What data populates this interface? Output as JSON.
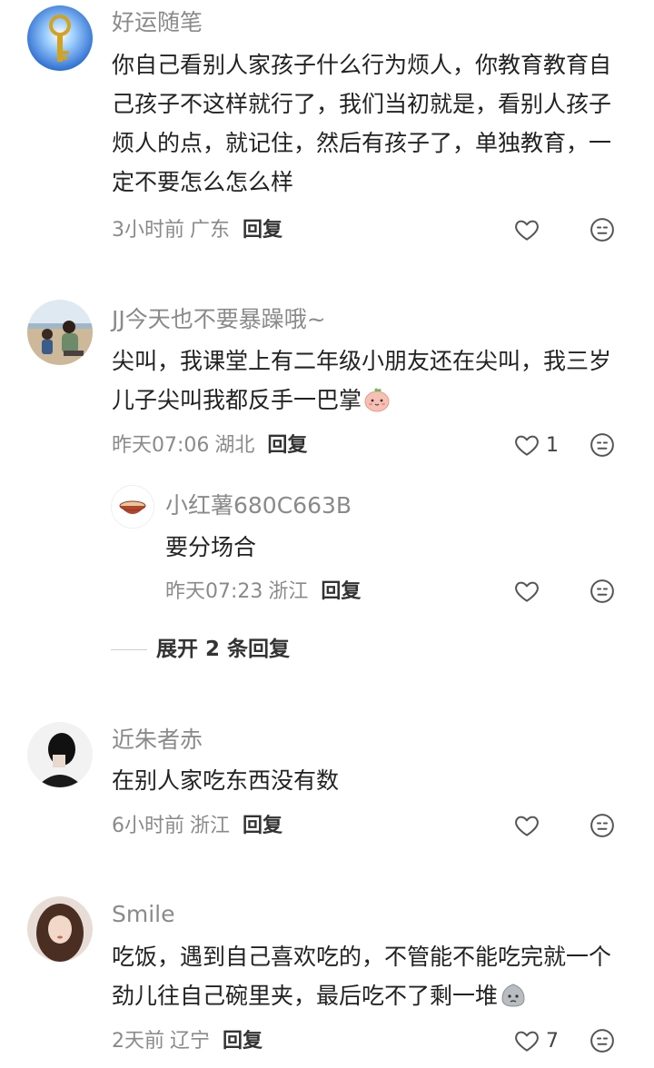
{
  "comments": [
    {
      "username": "好运随笔",
      "content": "你自己看别人家孩子什么行为烦人，你教育教育自己孩子不这样就行了，我们当初就是，看别人孩子烦人的点，就记住，然后有孩子了，单独教育，一定不要怎么怎么样",
      "time": "3小时前",
      "location": "广东",
      "reply_label": "回复",
      "like_count": "",
      "avatar_icon": "golden-key-avatar"
    },
    {
      "username": "JJ今天也不要暴躁哦~",
      "content": "尖叫，我课堂上有二年级小朋友还在尖叫，我三岁儿子尖叫我都反手一巴掌",
      "emoji": "peach-face-emoji",
      "time": "昨天07:06",
      "location": "湖北",
      "reply_label": "回复",
      "like_count": "1",
      "avatar_icon": "beach-photo-avatar",
      "replies": [
        {
          "username": "小红薯680C663B",
          "content": "要分场合",
          "time": "昨天07:23",
          "location": "浙江",
          "reply_label": "回复",
          "like_count": "",
          "avatar_icon": "bowl-avatar"
        }
      ],
      "expand_label": "展开 2 条回复"
    },
    {
      "username": "近朱者赤",
      "content": "在别人家吃东西没有数",
      "time": "6小时前",
      "location": "浙江",
      "reply_label": "回复",
      "like_count": "",
      "avatar_icon": "silhouette-avatar"
    },
    {
      "username": "Smile",
      "content": "吃饭，遇到自己喜欢吃的，不管能不能吃完就一个劲儿往自己碗里夹，最后吃不了剩一堆",
      "emoji": "gray-face-emoji",
      "time": "2天前",
      "location": "辽宁",
      "reply_label": "回复",
      "like_count": "7",
      "avatar_icon": "girl-portrait-avatar"
    }
  ],
  "colors": {
    "text": "#222222",
    "secondary": "#8a8a8a",
    "background": "#ffffff"
  }
}
